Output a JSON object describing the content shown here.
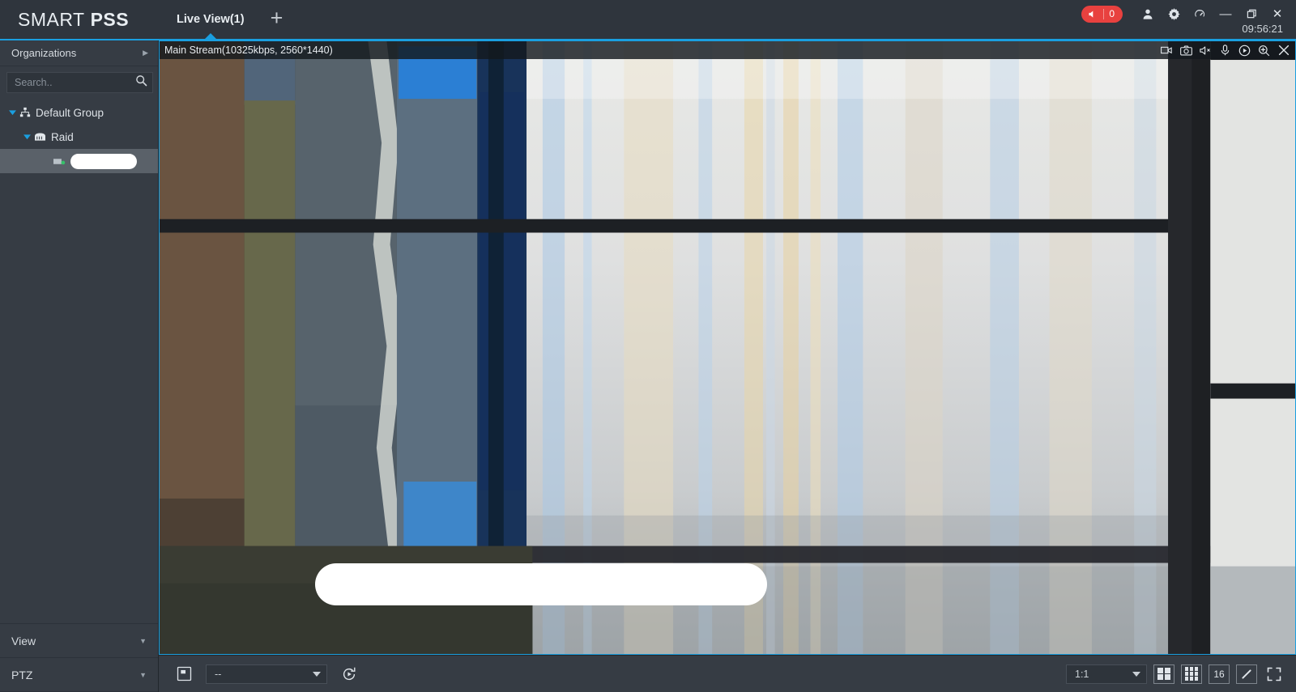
{
  "app": {
    "brand_light": "SMART",
    "brand_bold": "PSS",
    "clock": "09:56:21",
    "accent": "#1a9fe0",
    "alarm_color": "#e8413f"
  },
  "titlebar": {
    "tabs": [
      {
        "label": "Live View(1)",
        "active": true
      }
    ],
    "add_tab_label": "+",
    "alarm": {
      "count": "0",
      "icon": "speaker-icon"
    },
    "icons": [
      {
        "name": "user-icon"
      },
      {
        "name": "gear-icon"
      },
      {
        "name": "dashboard-icon"
      }
    ],
    "window_controls": [
      {
        "name": "minimize-button",
        "glyph": "—"
      },
      {
        "name": "maximize-button",
        "glyph": "❐"
      },
      {
        "name": "close-button",
        "glyph": "✕"
      }
    ]
  },
  "sidebar": {
    "header": {
      "title": "Organizations",
      "chevron": "▶"
    },
    "search": {
      "value": "",
      "placeholder": "Search..",
      "icon": "search-icon"
    },
    "tree": [
      {
        "label": "Default Group",
        "level": 0,
        "expanded": true,
        "icon": "group-icon",
        "selected": false
      },
      {
        "label": "Raid",
        "level": 1,
        "expanded": true,
        "icon": "device-icon",
        "selected": false
      },
      {
        "label": "",
        "level": 2,
        "expanded": false,
        "icon": "camera-icon",
        "selected": true,
        "redacted": true
      }
    ],
    "accordions": [
      {
        "label": "View",
        "chevron": "▼"
      },
      {
        "label": "PTZ",
        "chevron": "▼"
      }
    ]
  },
  "video": {
    "stream_label": "Main Stream(10325kbps, 2560*1440)",
    "toolbar_icons": [
      {
        "name": "record-icon"
      },
      {
        "name": "snapshot-icon"
      },
      {
        "name": "speaker-mute-icon"
      },
      {
        "name": "microphone-icon"
      },
      {
        "name": "playback-icon"
      },
      {
        "name": "zoom-in-icon"
      },
      {
        "name": "close-icon"
      }
    ],
    "redaction_overlay": true
  },
  "bottombar": {
    "save_icon": "save-view-icon",
    "preset_select": {
      "value": "--",
      "placeholder": "--"
    },
    "refresh_icon": "tour-refresh-icon",
    "ratio_select": {
      "value": "1:1"
    },
    "layout_buttons": [
      {
        "name": "split-4-button",
        "label": ""
      },
      {
        "name": "split-9-button",
        "label": ""
      },
      {
        "name": "split-16-button",
        "label": "16"
      },
      {
        "name": "custom-split-button",
        "label": ""
      },
      {
        "name": "fullscreen-button",
        "label": ""
      }
    ]
  }
}
